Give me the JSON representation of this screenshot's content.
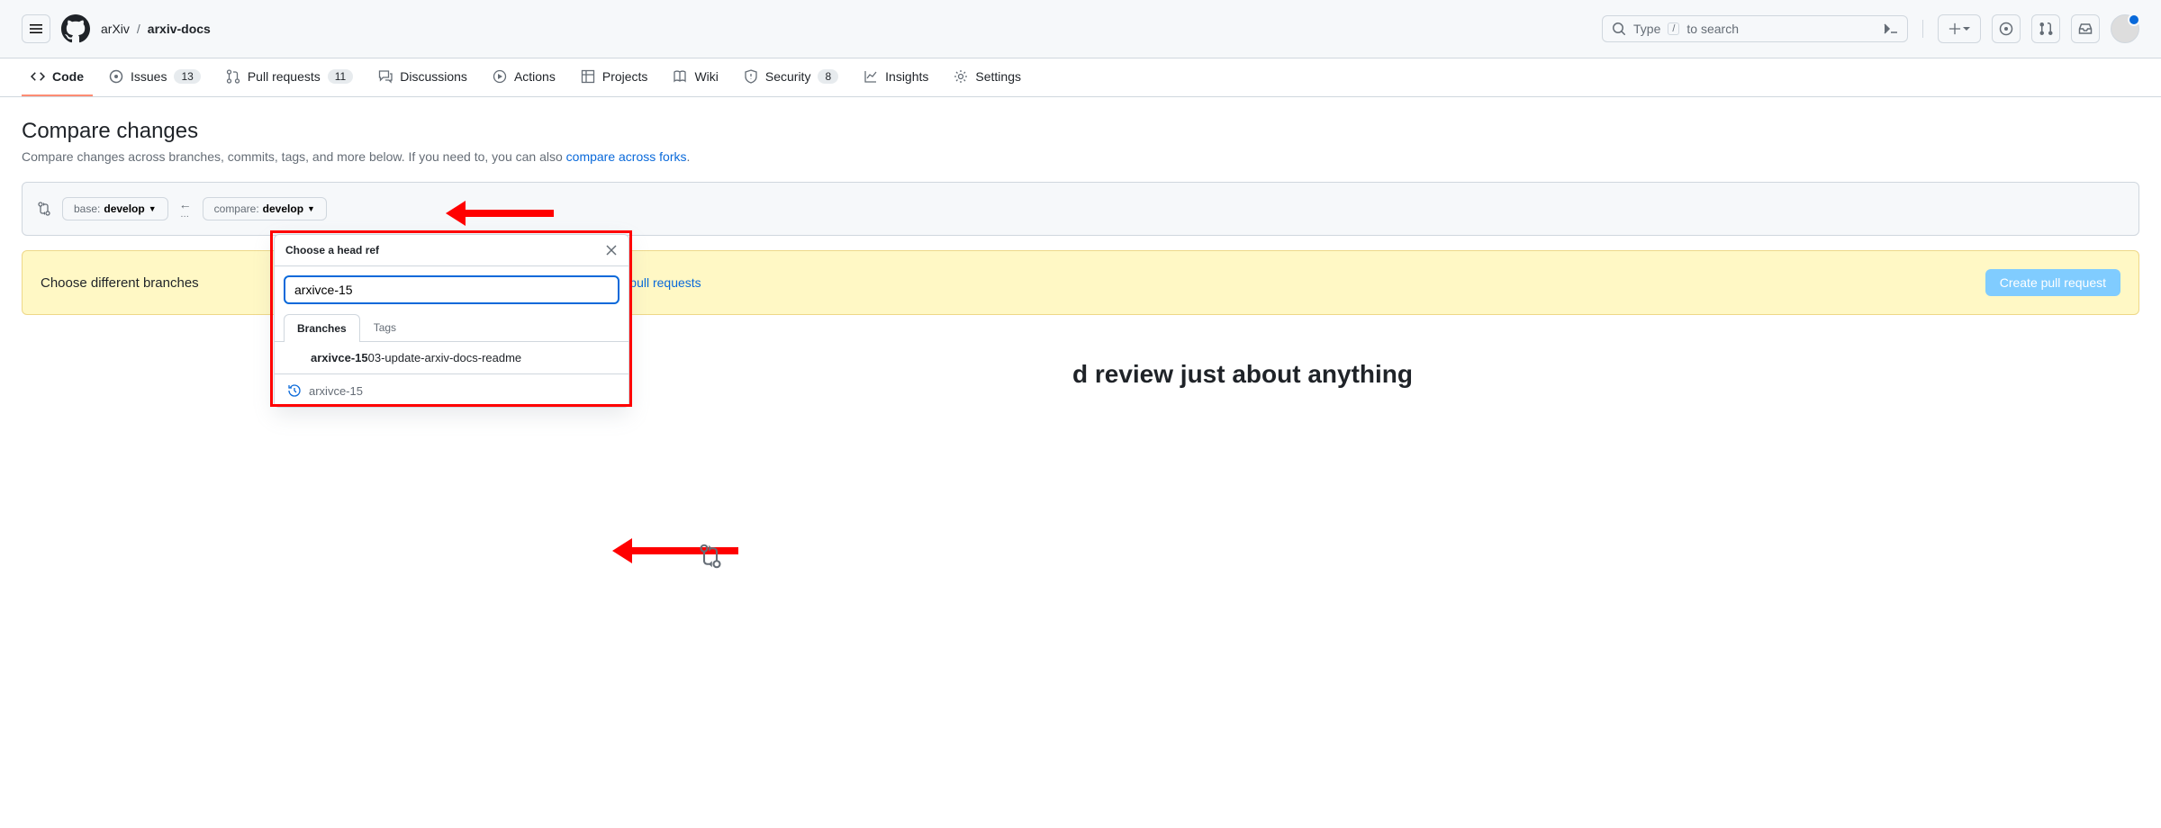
{
  "header": {
    "owner": "arXiv",
    "repo": "arxiv-docs",
    "search_placeholder_pre": "Type",
    "search_slash": "/",
    "search_placeholder_post": "to search"
  },
  "nav": {
    "code": "Code",
    "issues": "Issues",
    "issues_count": "13",
    "pulls": "Pull requests",
    "pulls_count": "11",
    "discussions": "Discussions",
    "actions": "Actions",
    "projects": "Projects",
    "wiki": "Wiki",
    "security": "Security",
    "security_count": "8",
    "insights": "Insights",
    "settings": "Settings"
  },
  "page": {
    "title": "Compare changes",
    "subtitle_pre": "Compare changes across branches, commits, tags, and more below. If you need to, you can also ",
    "subtitle_link": "compare across forks",
    "subtitle_post": "."
  },
  "compare_bar": {
    "base_label": "base:",
    "base_value": "develop",
    "compare_label": "compare:",
    "compare_value": "develop"
  },
  "banner": {
    "text_pre": "Choose different branches",
    "text_gap": " ",
    "link": "Learn about pull requests",
    "button": "Create pull request"
  },
  "popup": {
    "title": "Choose a head ref",
    "input_value": "arxivce-15",
    "tab_branches": "Branches",
    "tab_tags": "Tags",
    "result_match": "arxivce-15",
    "result_rest": "03-update-arxiv-docs-readme",
    "recent": "arxivce-15"
  },
  "footer_text": "d review just about anything"
}
